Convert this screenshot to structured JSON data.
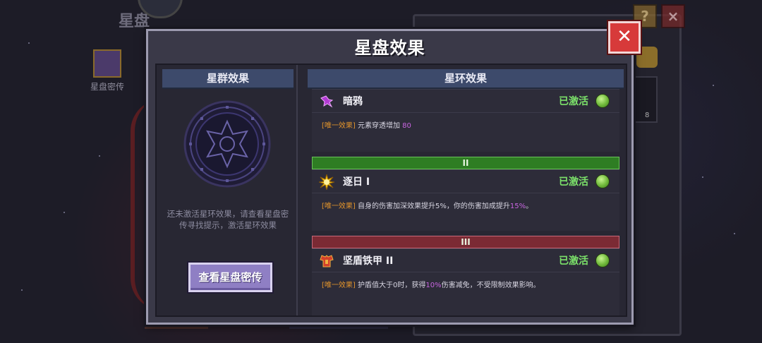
{
  "background": {
    "title": "星盘",
    "codex_label": "星盘密传",
    "slot_count": "8"
  },
  "modal": {
    "title": "星盘效果",
    "close_icon": "close-icon"
  },
  "left_panel": {
    "header": "星群效果",
    "hint": "还未激活星环效果，请查看星盘密传寻找提示，激活星环效果",
    "button_label": "查看星盘密传"
  },
  "right_panel": {
    "header": "星环效果",
    "entries": [
      {
        "icon": "dark-crow-icon",
        "name": "暗鸦",
        "status": "已激活",
        "tag": "[唯一效果]",
        "desc_before": " 元素穿透增加 ",
        "highlight": "80",
        "desc_after": ""
      },
      {
        "tier": "II",
        "icon": "sun-icon",
        "name": "逐日 I",
        "status": "已激活",
        "tag": "[唯一效果]",
        "desc_before": " 自身的伤害加深效果提升5%，你的伤害加成提升",
        "highlight": "15%",
        "desc_after": "。"
      },
      {
        "tier": "III",
        "icon": "armor-icon",
        "name": "坚盾铁甲 II",
        "status": "已激活",
        "tag": "[唯一效果]",
        "desc_before": " 护盾值大于0时，获得",
        "highlight": "10%",
        "desc_after": "伤害减免，不受限制效果影响。"
      }
    ]
  },
  "colors": {
    "active_green": "#7ce26a",
    "tag_orange": "#e0932c",
    "highlight_purple": "#c865e0",
    "tier2_bar": "#2e7d23",
    "tier3_bar": "#7b2a34",
    "close_red": "#d73a3a"
  }
}
